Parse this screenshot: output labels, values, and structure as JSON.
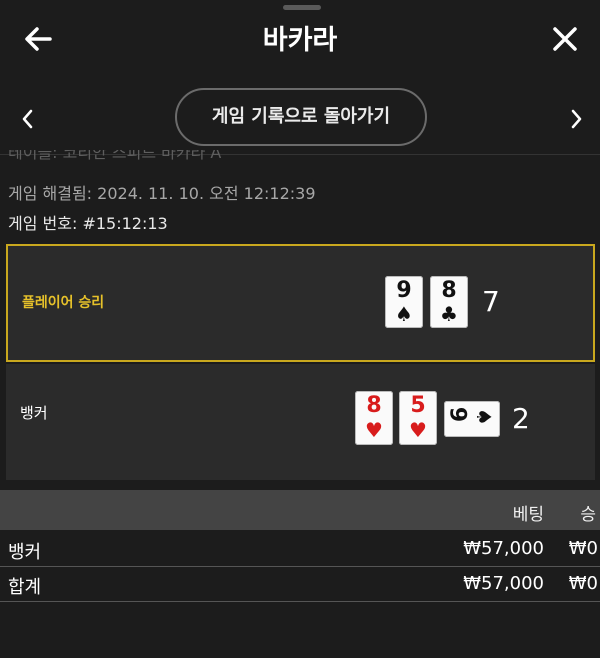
{
  "header": {
    "title": "바카라",
    "back_icon": "arrow-left-icon",
    "close_icon": "close-icon"
  },
  "nav": {
    "history_button": "게임 기록으로 돌아가기",
    "prev_icon": "chevron-left-icon",
    "next_icon": "chevron-right-icon"
  },
  "meta": {
    "table_name": "테이블: 코리안 스피드 바카라 A",
    "resolved": "게임 해결됨: 2024. 11. 10. 오전 12:12:39",
    "game_number": "게임 번호: #15:12:13"
  },
  "player": {
    "label": "플레이어 승리",
    "cards": [
      {
        "rank": "9",
        "suit": "♠",
        "color": "black"
      },
      {
        "rank": "8",
        "suit": "♣",
        "color": "black"
      }
    ],
    "score": "7"
  },
  "banker": {
    "label": "뱅커",
    "cards": [
      {
        "rank": "8",
        "suit": "♥",
        "color": "red"
      },
      {
        "rank": "5",
        "suit": "♥",
        "color": "red"
      },
      {
        "rank": "9",
        "suit": "♠",
        "color": "black",
        "rotated": true
      }
    ],
    "score": "2"
  },
  "bets": {
    "headers": [
      "베팅",
      "승"
    ],
    "rows": [
      {
        "name": "뱅커",
        "bet": "₩57,000",
        "win": "₩0"
      },
      {
        "name": "합계",
        "bet": "₩57,000",
        "win": "₩0"
      }
    ]
  },
  "colors": {
    "background": "#1c1c1c",
    "panel": "#2b2b2b",
    "winner_border": "#c9a81e",
    "winner_text": "#e6c12a",
    "table_header": "#444444"
  }
}
